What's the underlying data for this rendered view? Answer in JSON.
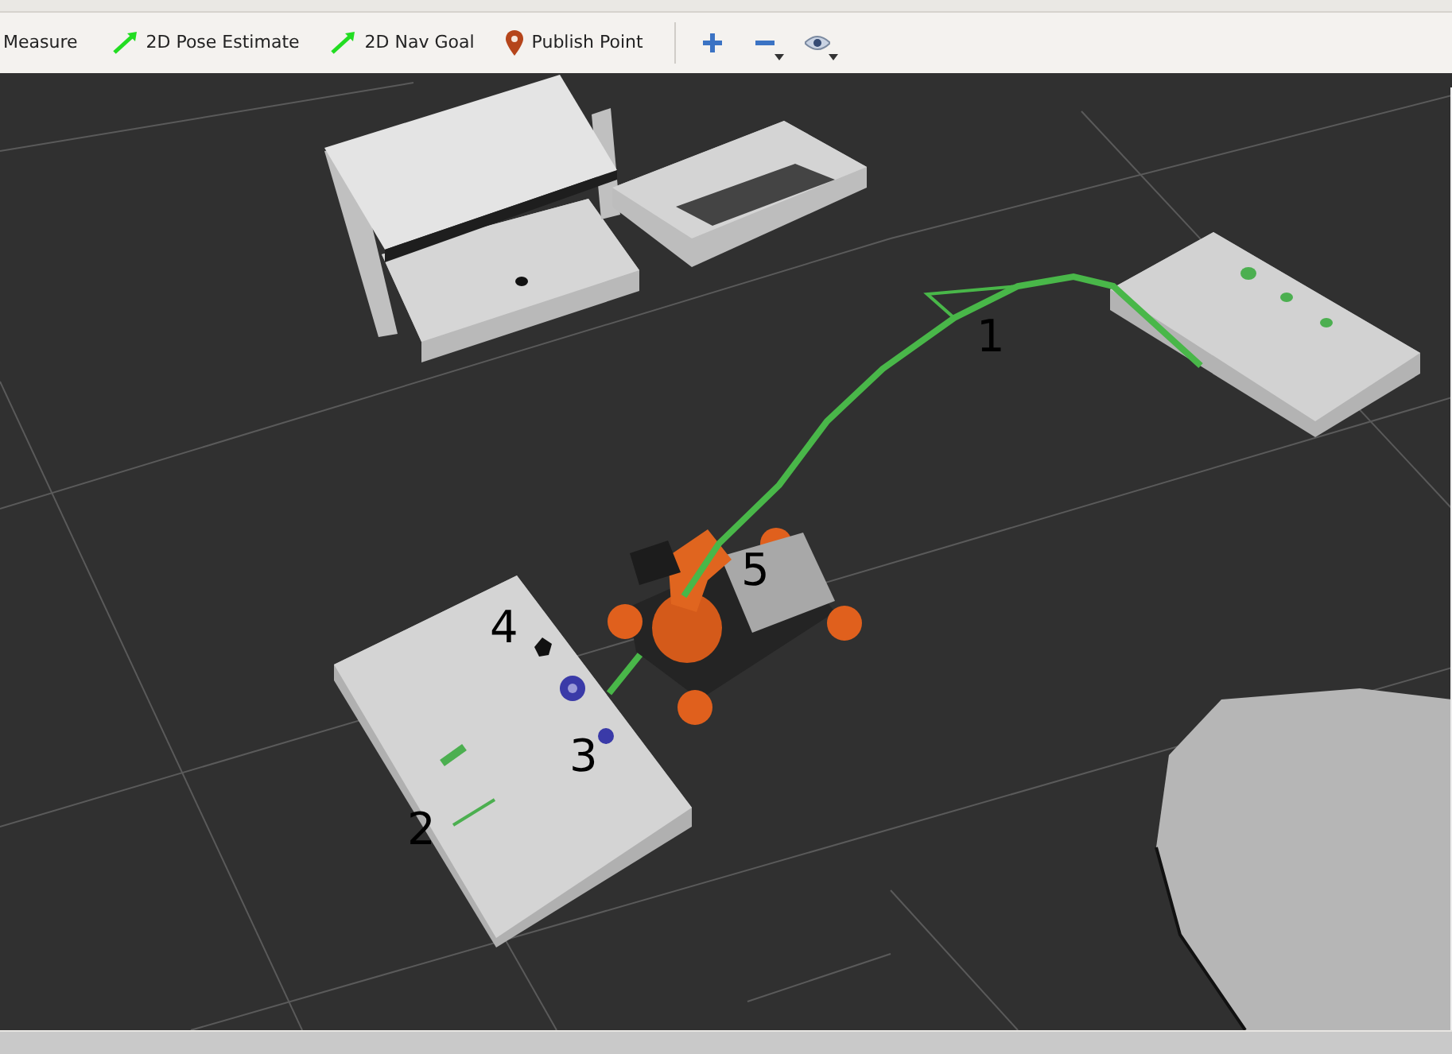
{
  "toolbar": {
    "tools": [
      {
        "label": "Measure",
        "kind": "plain"
      },
      {
        "label": "2D Pose Estimate",
        "kind": "arrow"
      },
      {
        "label": "2D Nav Goal",
        "kind": "arrow"
      },
      {
        "label": "Publish Point",
        "kind": "pin"
      }
    ]
  },
  "viewport": {
    "markers": [
      {
        "label": "1"
      },
      {
        "label": "2"
      },
      {
        "label": "3"
      },
      {
        "label": "4"
      },
      {
        "label": "5"
      }
    ]
  }
}
